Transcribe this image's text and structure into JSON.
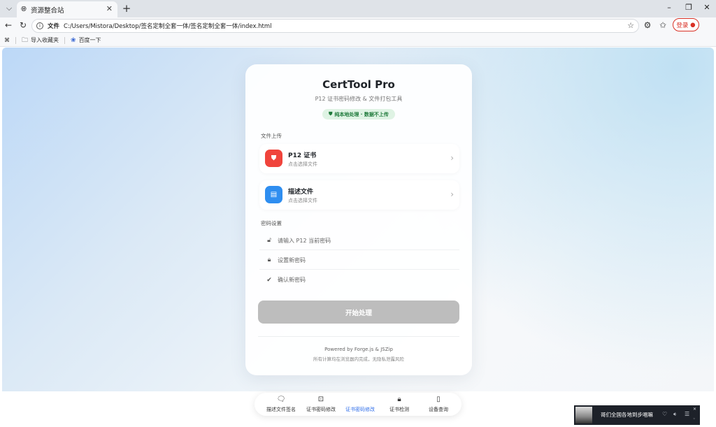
{
  "browser": {
    "tab_title": "资源整合站",
    "address_label": "文件",
    "url": "C:/Users/Mistora/Desktop/签名定制全套一体/签名定制全套一体/index.html",
    "login_label": "登录",
    "bookmarks": [
      "导入收藏夹",
      "百度一下"
    ]
  },
  "app": {
    "title": "CertTool Pro",
    "subtitle": "P12 证书密码修改 & 文件打包工具",
    "privacy_badge": "纯本地处理 · 数据不上传",
    "upload_section_label": "文件上传",
    "files": [
      {
        "name": "P12 证书",
        "hint": "点击选择文件",
        "icon": "shield-icon",
        "color": "#f0443c"
      },
      {
        "name": "描述文件",
        "hint": "点击选择文件",
        "icon": "file-icon",
        "color": "#2f8ef0"
      }
    ],
    "password_section_label": "密码设置",
    "password_fields": [
      {
        "placeholder": "请输入 P12 当前密码",
        "icon": "unlock-icon"
      },
      {
        "placeholder": "设置新密码",
        "icon": "lock-icon"
      },
      {
        "placeholder": "确认新密码",
        "icon": "check-circle-icon"
      }
    ],
    "submit_label": "开始处理",
    "footer_powered": "Powered by Forge.js & JSZip",
    "footer_note": "所有计算均在浏览器内完成，无隐私泄露风险"
  },
  "bottom_nav": {
    "items": [
      {
        "label": "描述文件签名",
        "icon": "chat-icon"
      },
      {
        "label": "证书密码修改",
        "icon": "alert-box-icon"
      },
      {
        "label": "证书密码修改",
        "icon": "dot-icon",
        "active": true
      },
      {
        "label": "证书检测",
        "icon": "lock-icon"
      },
      {
        "label": "设备查询",
        "icon": "phone-icon"
      }
    ]
  },
  "media": {
    "title": "哥们全国各地到步唱嘛"
  }
}
